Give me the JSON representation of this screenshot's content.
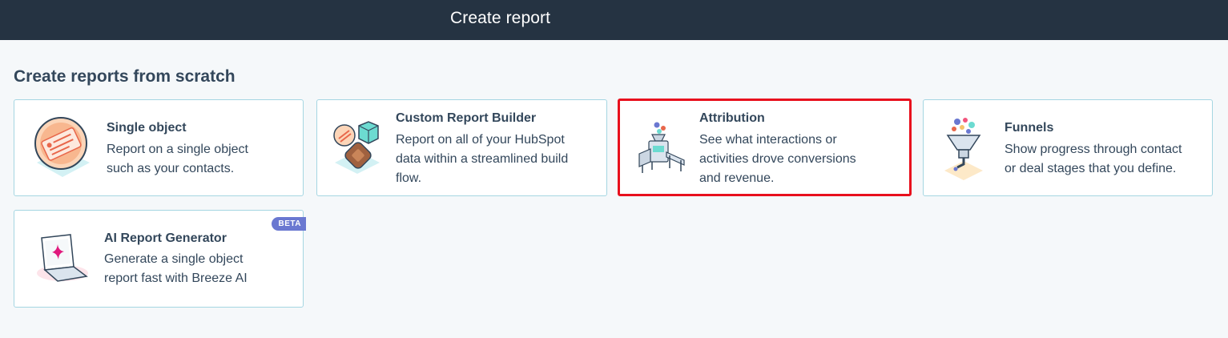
{
  "header": {
    "title": "Create report"
  },
  "section": {
    "title": "Create reports from scratch"
  },
  "cards": [
    {
      "title": "Single object",
      "desc_lines": [
        "Report on a single object",
        "such as your contacts."
      ],
      "icon": "single-object-icon"
    },
    {
      "title": "Custom Report Builder",
      "desc_lines": [
        "Report on all of your HubSpot",
        "data within a streamlined build",
        "flow."
      ],
      "icon": "custom-report-builder-icon"
    },
    {
      "title": "Attribution",
      "desc_lines": [
        "See what interactions or",
        "activities drove conversions",
        "and revenue."
      ],
      "icon": "attribution-icon",
      "selected": true
    },
    {
      "title": "Funnels",
      "desc_lines": [
        "Show progress through contact",
        "or deal stages that you define."
      ],
      "icon": "funnel-icon"
    },
    {
      "title": "AI Report Generator",
      "desc_lines": [
        "Generate a single object",
        "report fast with Breeze AI"
      ],
      "icon": "laptop-sparkle-icon",
      "badge": "BETA"
    }
  ],
  "colors": {
    "header_bg": "#253342",
    "page_bg": "#f5f8fa",
    "card_border": "#a5d6e2",
    "selected_border": "#e8101d",
    "beta_badge": "#6a78d1"
  }
}
